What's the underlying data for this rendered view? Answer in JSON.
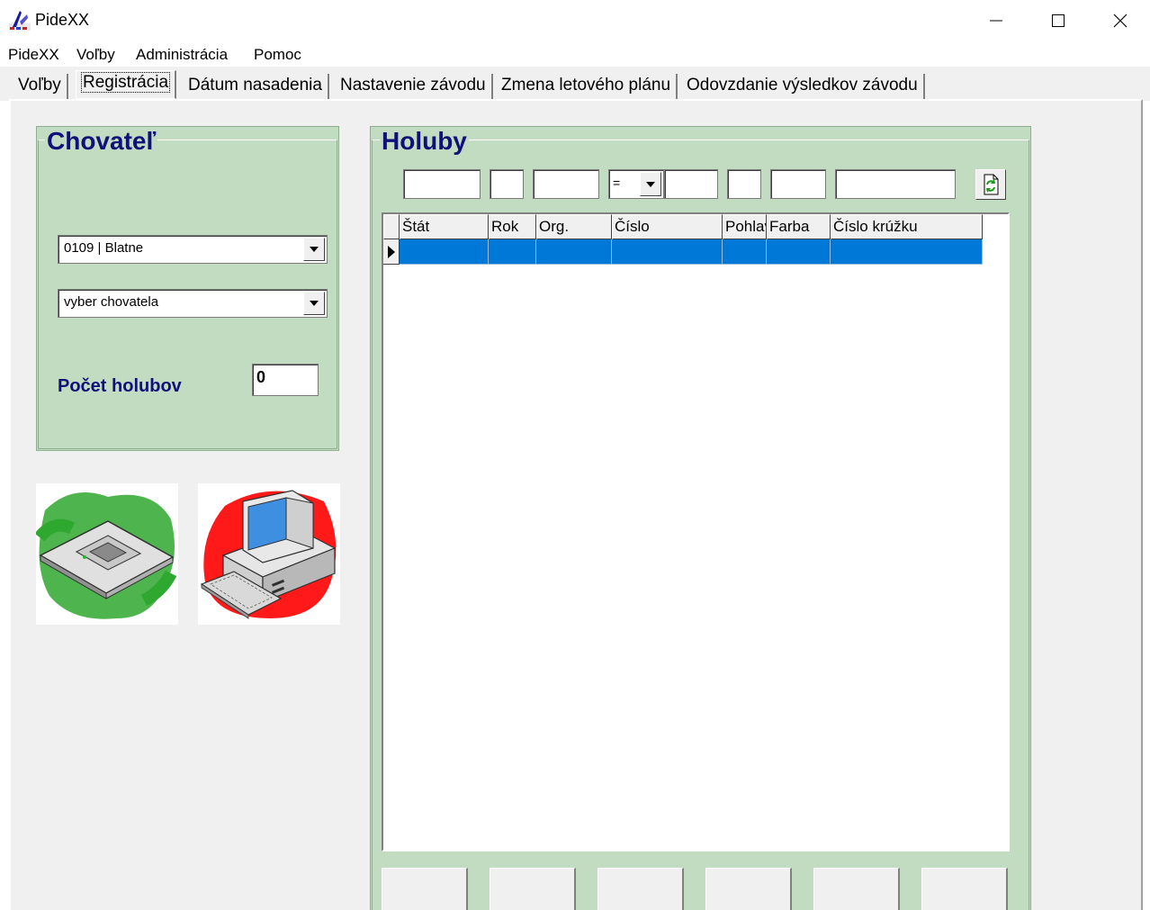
{
  "window": {
    "title": "PideXX"
  },
  "menu": [
    "PideXX",
    "Voľby",
    "Administrácia",
    "Pomoc"
  ],
  "tabs": [
    {
      "label": "Voľby",
      "active": false
    },
    {
      "label": "Registrácia",
      "active": true
    },
    {
      "label": "Dátum nasadenia",
      "active": false
    },
    {
      "label": "Nastavenie závodu",
      "active": false
    },
    {
      "label": "Zmena letového plánu",
      "active": false
    },
    {
      "label": "Odovzdanie výsledkov závodu",
      "active": false
    }
  ],
  "chovatel": {
    "title": "Chovateľ",
    "org_combo_value": "0109 | Blatne",
    "breeder_combo_value": "vyber chovatela",
    "pocet_label": "Počet holubov",
    "pocet_value": "0"
  },
  "holuby": {
    "title": "Holuby",
    "filter_operator": "=",
    "columns": [
      "Štát",
      "Rok",
      "Org.",
      "Číslo",
      "Pohlavie",
      "Farba",
      "Číslo krúžku"
    ],
    "rows": [
      [
        "",
        "",
        "",
        "",
        "",
        "",
        ""
      ]
    ]
  },
  "icons": {
    "chip": "chip-device-icon",
    "computer": "computer-icon",
    "refresh": "refresh-icon"
  },
  "colors": {
    "group_bg": "#c1dcc1",
    "title_blue": "#10107a",
    "selection": "#0078d7",
    "chip_highlight": "#2fa82f",
    "computer_highlight": "#ff0000"
  }
}
